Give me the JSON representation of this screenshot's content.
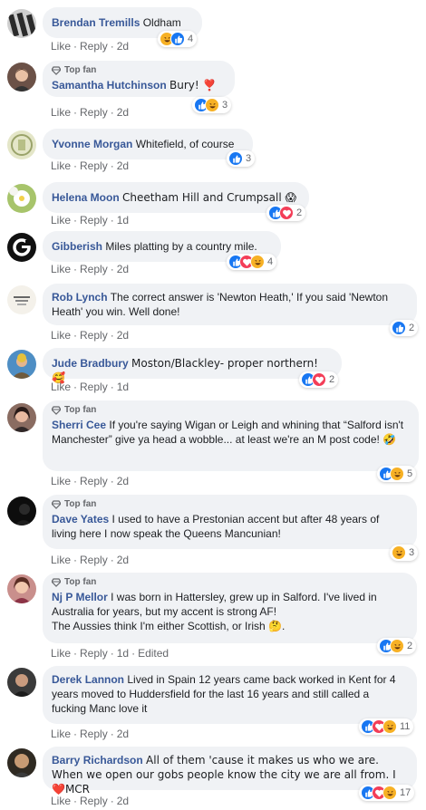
{
  "actions": {
    "like": "Like",
    "reply": "Reply",
    "edited": "Edited",
    "badge": "Top fan"
  },
  "comments": [
    {
      "author": "Brendan Tremills",
      "text": "Oldham",
      "time": "2d",
      "top_fan": false,
      "reactions": [
        "haha",
        "like"
      ],
      "count": "4"
    },
    {
      "author": "Samantha Hutchinson",
      "text": "Bury! ❣️",
      "time": "2d",
      "top_fan": true,
      "reactions": [
        "like",
        "haha"
      ],
      "count": "3"
    },
    {
      "author": "Yvonne Morgan",
      "text": "Whitefield, of course",
      "time": "2d",
      "top_fan": false,
      "reactions": [
        "like"
      ],
      "count": "3"
    },
    {
      "author": "Helena Moon",
      "text": "Cheetham Hill and Crumpsall 😱",
      "time": "1d",
      "top_fan": false,
      "reactions": [
        "like",
        "love"
      ],
      "count": "2"
    },
    {
      "author": "Gibberish",
      "text": "Miles platting by a country mile.",
      "time": "2d",
      "top_fan": false,
      "reactions": [
        "like",
        "love",
        "haha"
      ],
      "count": "4"
    },
    {
      "author": "Rob Lynch",
      "text": "The correct answer is 'Newton Heath,' If you said 'Newton Heath' you win. Well done!",
      "time": "2d",
      "top_fan": false,
      "reactions": [
        "like"
      ],
      "count": "2"
    },
    {
      "author": "Jude Bradbury",
      "text": "Moston/Blackley- proper northern!🥰",
      "time": "1d",
      "top_fan": false,
      "reactions": [
        "like",
        "love"
      ],
      "count": "2"
    },
    {
      "author": "Sherri Cee",
      "text": "If you're saying Wigan or Leigh and whining that “Salford isn't Manchester” give ya head a wobble... at least we're an M post code! 🤣",
      "time": "2d",
      "top_fan": true,
      "reactions": [
        "like",
        "haha"
      ],
      "count": "5"
    },
    {
      "author": "Dave Yates",
      "text": "I used to have a Prestonian accent but after 48 years of living here I now speak the Queens Mancunian!",
      "time": "2d",
      "top_fan": true,
      "reactions": [
        "haha"
      ],
      "count": "3"
    },
    {
      "author": "Nj P Mellor",
      "text": "I was born in Hattersley, grew up in Salford. I've lived in Australia for years, but my accent is strong AF!\nThe Aussies think I'm either Scottish, or Irish 🤔.",
      "time": "1d",
      "top_fan": true,
      "edited": true,
      "reactions": [
        "haha"
      ],
      "count": "2"
    },
    {
      "author": "Derek Lannon",
      "text": "Lived in Spain 12 years came back worked in Kent for 4 years moved to Huddersfield for the last 16 years and still called a fucking Manc love it",
      "time": "2d",
      "top_fan": false,
      "reactions": [
        "like",
        "love",
        "haha"
      ],
      "count": "11"
    },
    {
      "author": "Barry Richardson",
      "text": "All of them 'cause it makes us who we are. When we open our gobs people know the city we are all from. I❤️MCR",
      "time": "2d",
      "top_fan": false,
      "reactions": [
        "like",
        "love",
        "haha"
      ],
      "count": "17"
    }
  ]
}
